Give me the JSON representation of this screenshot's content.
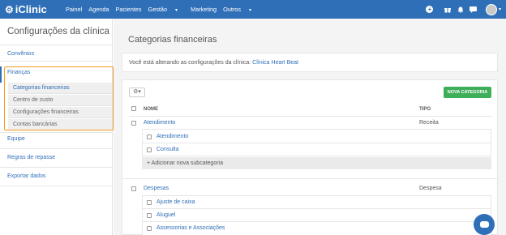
{
  "app": {
    "logo_text": "iClinic"
  },
  "nav": {
    "items": [
      "Painel",
      "Agenda",
      "Pacientes",
      "Gestão",
      "Marketing",
      "Outros"
    ]
  },
  "sidebar": {
    "title": "Configurações da clínica",
    "links": {
      "convenios": "Convênios",
      "financas": "Finanças",
      "equipe": "Equipe",
      "regras": "Regras de repasse",
      "exportar": "Exportar dados"
    },
    "financas_items": [
      "Categorias financeiras",
      "Centro de custo",
      "Configurações financeiras",
      "Contas bancárias"
    ]
  },
  "main": {
    "title": "Categorias financeiras",
    "notice_prefix": "Você está alterando as configurações da clínica:",
    "clinic_name": "Clínica Heart Beat",
    "new_button": "NOVA CATEGORIA",
    "col_name": "NOME",
    "col_type": "TIPO",
    "categories": [
      {
        "name": "Atendimento",
        "type": "Receita",
        "subs": [
          "Atendimento",
          "Consulta"
        ],
        "add_sub": "Adicionar nova subcategoria"
      },
      {
        "name": "Despesas",
        "type": "Despesa",
        "subs": [
          "Ajuste de caixa",
          "Aluguel",
          "Assessorias e Associações"
        ]
      }
    ]
  },
  "colors": {
    "brand_blue": "#2f6fb8",
    "highlight_orange": "#f29a1f",
    "button_green": "#3fae5a"
  }
}
